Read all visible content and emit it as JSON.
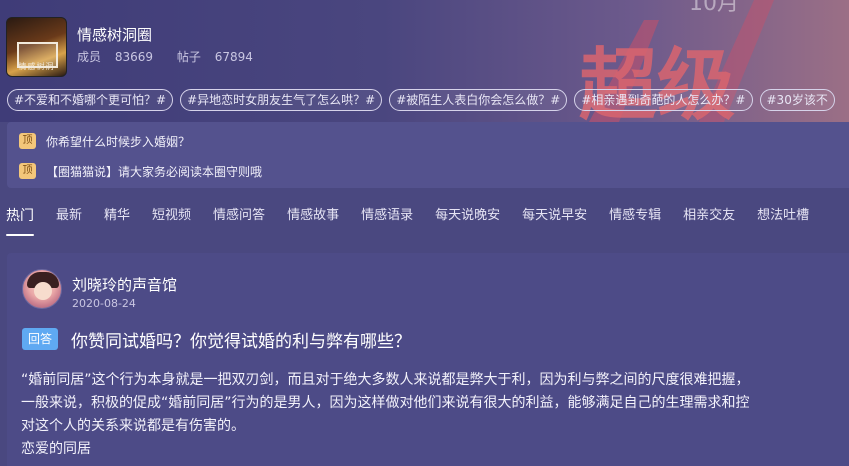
{
  "circle": {
    "name": "情感树洞圈",
    "members_label": "成员",
    "members": "83669",
    "posts_label": "帖子",
    "posts": "67894",
    "avatar_caption": "情感树洞"
  },
  "banner": {
    "big_text": "超级",
    "small_text": "10月"
  },
  "tags": [
    "#不爱和不婚哪个更可怕？#",
    "#异地恋时女朋友生气了怎么哄？#",
    "#被陌生人表白你会怎么做？#",
    "#相亲遇到奇葩的人怎么办？#",
    "#30岁该不"
  ],
  "pinned": {
    "badge": "顶",
    "items": [
      "你希望什么时候步入婚姻？",
      "【圈猫猫说】请大家务必阅读本圈守则哦"
    ]
  },
  "tabs": [
    "热门",
    "最新",
    "精华",
    "短视频",
    "情感问答",
    "情感故事",
    "情感语录",
    "每天说晚安",
    "每天说早安",
    "情感专辑",
    "相亲交友",
    "想法吐槽"
  ],
  "post": {
    "author": "刘晓玲的声音馆",
    "date": "2020-08-24",
    "type_badge": "回答",
    "title": "你赞同试婚吗？你觉得试婚的利与弊有哪些？",
    "body": [
      "“婚前同居”这个行为本身就是一把双刃剑，而且对于绝大多数人来说都是弊大于利，因为利与弊之间的尺度很难把握，",
      "一般来说，积极的促成“婚前同居”行为的是男人，因为这样做对他们来说有很大的利益，能够满足自己的生理需求和控",
      "对这个人的关系来说都是有伤害的。",
      "恋爱的同居"
    ]
  },
  "colors": {
    "background": "#4a4880",
    "pin_badge": "#f4c77a",
    "answer_badge": "#5fa9f2"
  }
}
